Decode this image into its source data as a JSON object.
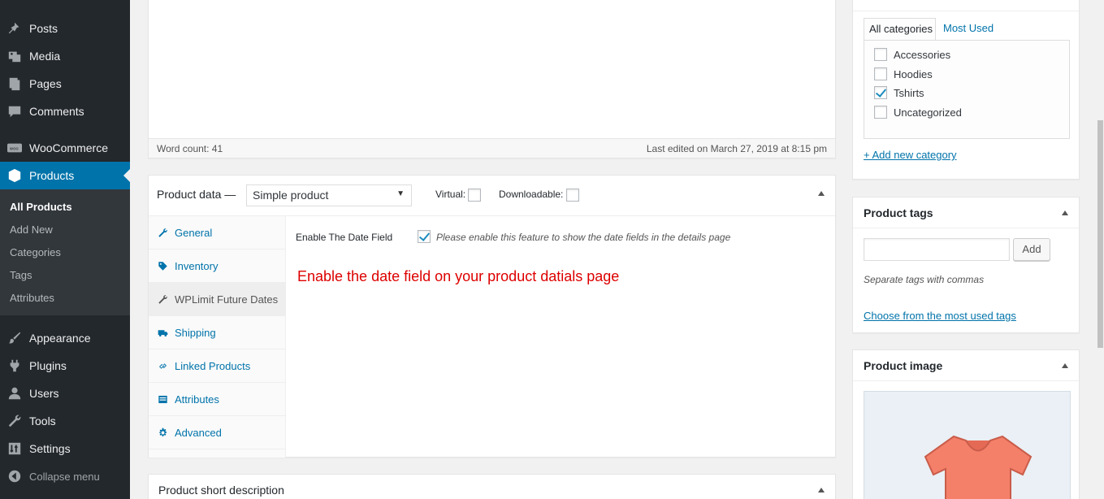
{
  "sidebar": {
    "items": [
      {
        "label": "Posts",
        "icon": "pushpin-icon"
      },
      {
        "label": "Media",
        "icon": "media-icon"
      },
      {
        "label": "Pages",
        "icon": "pages-icon"
      },
      {
        "label": "Comments",
        "icon": "comments-icon"
      },
      {
        "label": "WooCommerce",
        "icon": "woocommerce-icon"
      },
      {
        "label": "Products",
        "icon": "products-icon"
      },
      {
        "label": "Appearance",
        "icon": "appearance-icon"
      },
      {
        "label": "Plugins",
        "icon": "plugins-icon"
      },
      {
        "label": "Users",
        "icon": "users-icon"
      },
      {
        "label": "Tools",
        "icon": "tools-icon"
      },
      {
        "label": "Settings",
        "icon": "settings-icon"
      }
    ],
    "submenu": [
      "All Products",
      "Add New",
      "Categories",
      "Tags",
      "Attributes"
    ],
    "collapse_label": "Collapse menu"
  },
  "editor": {
    "word_count": "Word count: 41",
    "last_edited": "Last edited on March 27, 2019 at 8:15 pm"
  },
  "product_data": {
    "title": "Product data —",
    "type_selected": "Simple product",
    "virtual_label": "Virtual:",
    "downloadable_label": "Downloadable:",
    "tabs": [
      "General",
      "Inventory",
      "WPLimit Future Dates",
      "Shipping",
      "Linked Products",
      "Attributes",
      "Advanced"
    ],
    "active_tab": "WPLimit Future Dates",
    "field_label": "Enable The Date Field",
    "field_description": "Please enable this feature to show the date fields in the details page",
    "field_checked": true,
    "annotation": "Enable the date field on your product datials page"
  },
  "short_description": {
    "title": "Product short description"
  },
  "categories": {
    "tab_all": "All categories",
    "tab_most_used": "Most Used",
    "items": [
      {
        "label": "Accessories",
        "checked": false
      },
      {
        "label": "Hoodies",
        "checked": false
      },
      {
        "label": "Tshirts",
        "checked": true
      },
      {
        "label": "Uncategorized",
        "checked": false
      }
    ],
    "add_new": "+ Add new category"
  },
  "tags": {
    "title": "Product tags",
    "add_button": "Add",
    "hint": "Separate tags with commas",
    "choose_link": "Choose from the most used tags"
  },
  "image": {
    "title": "Product image"
  },
  "colors": {
    "sidebar": "#23282d",
    "accent": "#0073aa",
    "annotation": "#dd0000"
  }
}
